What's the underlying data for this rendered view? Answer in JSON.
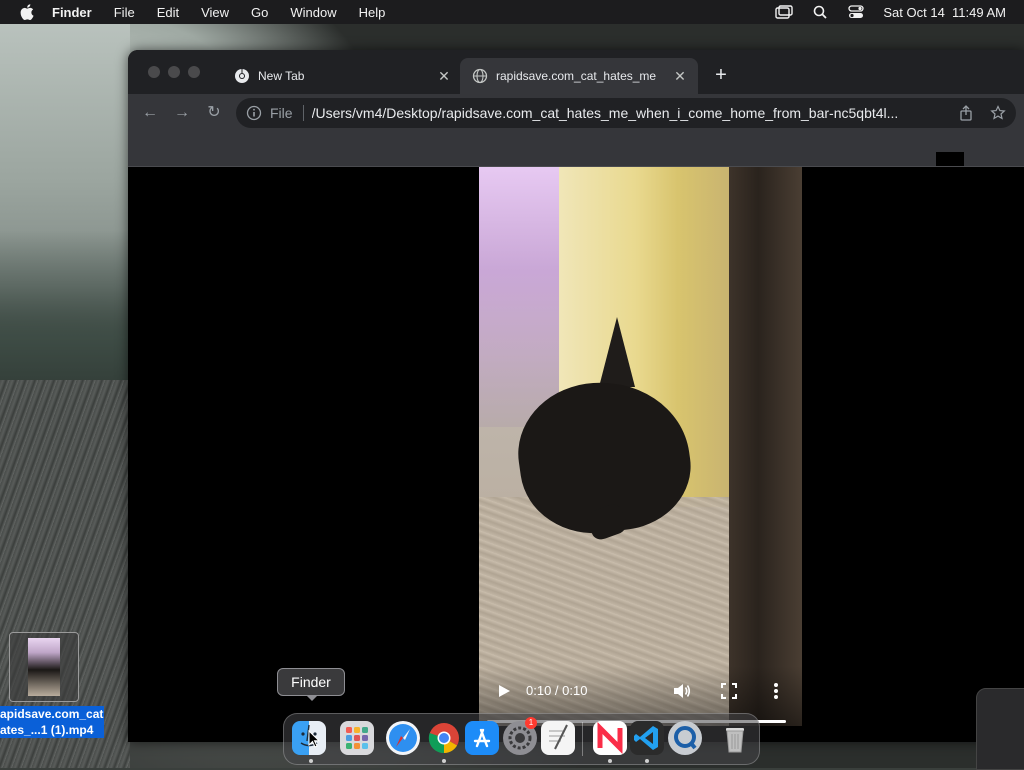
{
  "menubar": {
    "app_name": "Finder",
    "items": [
      "File",
      "Edit",
      "View",
      "Go",
      "Window",
      "Help"
    ],
    "datetime": "Sat Oct 14  11:49 AM",
    "status_icons": [
      "screen-mirror-icon",
      "search-icon",
      "control-center-icon"
    ]
  },
  "browser": {
    "tabs": [
      {
        "title": "New Tab",
        "icon": "chrome-icon",
        "active": false
      },
      {
        "title": "rapidsave.com_cat_hates_me",
        "icon": "globe-icon",
        "active": true
      }
    ],
    "omnibox": {
      "scheme": "File",
      "url": "/Users/vm4/Desktop/rapidsave.com_cat_hates_me_when_i_come_home_from_bar-nc5qbt4l..."
    }
  },
  "video": {
    "time": "0:10 / 0:10",
    "progress": 1.0
  },
  "desktop_file": {
    "label": "apidsave.com_cat\nates_...1 (1).mp4"
  },
  "dock": {
    "tooltip": "Finder",
    "items": [
      "finder-icon",
      "launchpad-icon",
      "safari-icon",
      "chrome-icon",
      "app-store-icon",
      "system-settings-icon",
      "textedit-icon",
      "news-icon",
      "vscode-icon",
      "quicktime-icon",
      "trash-icon"
    ],
    "badge": "1"
  },
  "colors": {
    "menubar_bg": "#1c1c1e",
    "chrome_dark": "#202124",
    "chrome_toolbar": "#35363a",
    "selection_blue": "#0a60d8"
  }
}
